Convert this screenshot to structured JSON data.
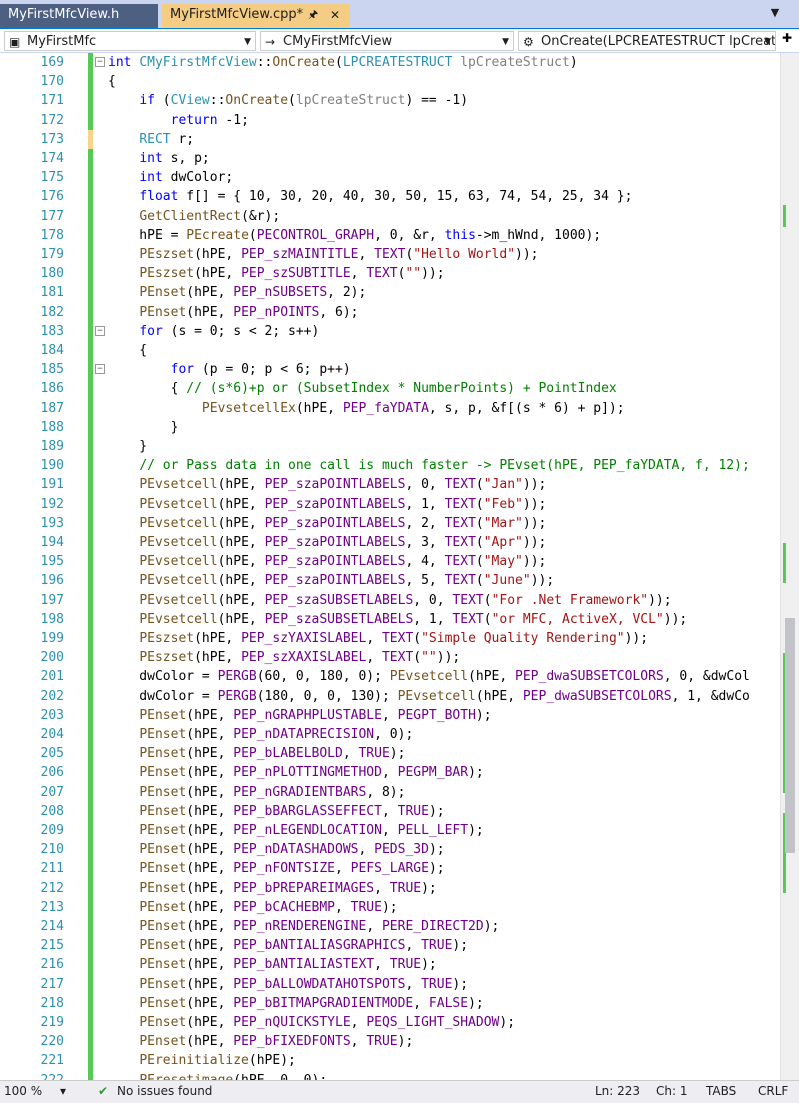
{
  "tabs": [
    {
      "label": "MyFirstMfcView.h",
      "active": false
    },
    {
      "label": "MyFirstMfcView.cpp*",
      "active": true
    }
  ],
  "nav": {
    "scope": "MyFirstMfc",
    "class": "CMyFirstMfcView",
    "member": "OnCreate(LPCREATESTRUCT lpCreat"
  },
  "colors": {
    "tab_active": "#f5cc84",
    "tab_inactive": "#4d6082",
    "line_number": "#2b91af",
    "keyword": "#0000ff",
    "string": "#a31515",
    "comment": "#008000",
    "macro": "#6f008a",
    "function": "#74531f",
    "type": "#2b91af",
    "saved_change": "#57c957",
    "unsaved_change": "#f9d58c"
  },
  "lines": [
    {
      "n": "169",
      "t": "int CMyFirstMfcView::OnCreate(LPCREATESTRUCT lpCreateStruct)",
      "fold": "−"
    },
    {
      "n": "170",
      "t": "{"
    },
    {
      "n": "171",
      "t": "    if (CView::OnCreate(lpCreateStruct) == -1)"
    },
    {
      "n": "172",
      "t": "        return -1;"
    },
    {
      "n": "173",
      "t": "    RECT r;",
      "bar": "unsaved"
    },
    {
      "n": "174",
      "t": "    int s, p;"
    },
    {
      "n": "175",
      "t": "    int dwColor;"
    },
    {
      "n": "176",
      "t": "    float f[] = { 10, 30, 20, 40, 30, 50, 15, 63, 74, 54, 25, 34 };"
    },
    {
      "n": "177",
      "t": "    GetClientRect(&r);"
    },
    {
      "n": "178",
      "t": "    hPE = PEcreate(PECONTROL_GRAPH, 0, &r, this->m_hWnd, 1000);"
    },
    {
      "n": "179",
      "t": "    PEszset(hPE, PEP_szMAINTITLE, TEXT(\"Hello World\"));"
    },
    {
      "n": "180",
      "t": "    PEszset(hPE, PEP_szSUBTITLE, TEXT(\"\"));"
    },
    {
      "n": "181",
      "t": "    PEnset(hPE, PEP_nSUBSETS, 2);"
    },
    {
      "n": "182",
      "t": "    PEnset(hPE, PEP_nPOINTS, 6);"
    },
    {
      "n": "183",
      "t": "    for (s = 0; s < 2; s++)",
      "fold": "−"
    },
    {
      "n": "184",
      "t": "    {"
    },
    {
      "n": "185",
      "t": "        for (p = 0; p < 6; p++)",
      "fold": "−"
    },
    {
      "n": "186",
      "t": "        { // (s*6)+p or (SubsetIndex * NumberPoints) + PointIndex"
    },
    {
      "n": "187",
      "t": "            PEvsetcellEx(hPE, PEP_faYDATA, s, p, &f[(s * 6) + p]);"
    },
    {
      "n": "188",
      "t": "        }"
    },
    {
      "n": "189",
      "t": "    }"
    },
    {
      "n": "190",
      "t": "    // or Pass data in one call is much faster -> PEvset(hPE, PEP_faYDATA, f, 12);"
    },
    {
      "n": "191",
      "t": "    PEvsetcell(hPE, PEP_szaPOINTLABELS, 0, TEXT(\"Jan\"));"
    },
    {
      "n": "192",
      "t": "    PEvsetcell(hPE, PEP_szaPOINTLABELS, 1, TEXT(\"Feb\"));"
    },
    {
      "n": "193",
      "t": "    PEvsetcell(hPE, PEP_szaPOINTLABELS, 2, TEXT(\"Mar\"));"
    },
    {
      "n": "194",
      "t": "    PEvsetcell(hPE, PEP_szaPOINTLABELS, 3, TEXT(\"Apr\"));"
    },
    {
      "n": "195",
      "t": "    PEvsetcell(hPE, PEP_szaPOINTLABELS, 4, TEXT(\"May\"));"
    },
    {
      "n": "196",
      "t": "    PEvsetcell(hPE, PEP_szaPOINTLABELS, 5, TEXT(\"June\"));"
    },
    {
      "n": "197",
      "t": "    PEvsetcell(hPE, PEP_szaSUBSETLABELS, 0, TEXT(\"For .Net Framework\"));"
    },
    {
      "n": "198",
      "t": "    PEvsetcell(hPE, PEP_szaSUBSETLABELS, 1, TEXT(\"or MFC, ActiveX, VCL\"));"
    },
    {
      "n": "199",
      "t": "    PEszset(hPE, PEP_szYAXISLABEL, TEXT(\"Simple Quality Rendering\"));"
    },
    {
      "n": "200",
      "t": "    PEszset(hPE, PEP_szXAXISLABEL, TEXT(\"\"));"
    },
    {
      "n": "201",
      "t": "    dwColor = PERGB(60, 0, 180, 0); PEvsetcell(hPE, PEP_dwaSUBSETCOLORS, 0, &dwCol"
    },
    {
      "n": "202",
      "t": "    dwColor = PERGB(180, 0, 0, 130); PEvsetcell(hPE, PEP_dwaSUBSETCOLORS, 1, &dwCo"
    },
    {
      "n": "203",
      "t": "    PEnset(hPE, PEP_nGRAPHPLUSTABLE, PEGPT_BOTH);"
    },
    {
      "n": "204",
      "t": "    PEnset(hPE, PEP_nDATAPRECISION, 0);"
    },
    {
      "n": "205",
      "t": "    PEnset(hPE, PEP_bLABELBOLD, TRUE);"
    },
    {
      "n": "206",
      "t": "    PEnset(hPE, PEP_nPLOTTINGMETHOD, PEGPM_BAR);"
    },
    {
      "n": "207",
      "t": "    PEnset(hPE, PEP_nGRADIENTBARS, 8);"
    },
    {
      "n": "208",
      "t": "    PEnset(hPE, PEP_bBARGLASSEFFECT, TRUE);"
    },
    {
      "n": "209",
      "t": "    PEnset(hPE, PEP_nLEGENDLOCATION, PELL_LEFT);"
    },
    {
      "n": "210",
      "t": "    PEnset(hPE, PEP_nDATASHADOWS, PEDS_3D);"
    },
    {
      "n": "211",
      "t": "    PEnset(hPE, PEP_nFONTSIZE, PEFS_LARGE);"
    },
    {
      "n": "212",
      "t": "    PEnset(hPE, PEP_bPREPAREIMAGES, TRUE);"
    },
    {
      "n": "213",
      "t": "    PEnset(hPE, PEP_bCACHEBMP, TRUE);"
    },
    {
      "n": "214",
      "t": "    PEnset(hPE, PEP_nRENDERENGINE, PERE_DIRECT2D);"
    },
    {
      "n": "215",
      "t": "    PEnset(hPE, PEP_bANTIALIASGRAPHICS, TRUE);"
    },
    {
      "n": "216",
      "t": "    PEnset(hPE, PEP_bANTIALIASTEXT, TRUE);"
    },
    {
      "n": "217",
      "t": "    PEnset(hPE, PEP_bALLOWDATAHOTSPOTS, TRUE);"
    },
    {
      "n": "218",
      "t": "    PEnset(hPE, PEP_bBITMAPGRADIENTMODE, FALSE);"
    },
    {
      "n": "219",
      "t": "    PEnset(hPE, PEP_nQUICKSTYLE, PEQS_LIGHT_SHADOW);"
    },
    {
      "n": "220",
      "t": "    PEnset(hPE, PEP_bFIXEDFONTS, TRUE);"
    },
    {
      "n": "221",
      "t": "    PEreinitialize(hPE);"
    },
    {
      "n": "222",
      "t": "    PEresetimage(hPE, 0, 0);"
    }
  ],
  "status": {
    "zoom": "100 %",
    "issues": "No issues found",
    "line": "Ln: 223",
    "col": "Ch: 1",
    "indent": "TABS",
    "eol": "CRLF"
  }
}
